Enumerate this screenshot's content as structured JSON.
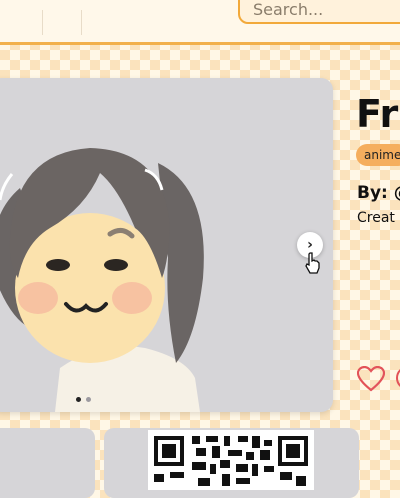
{
  "header": {
    "search": {
      "placeholder": "Search..."
    }
  },
  "mii": {
    "title": "Fri",
    "tags": [
      "anime"
    ],
    "author_prefix": "By: @",
    "created_label": "Creat",
    "carousel": {
      "slide_count": 2,
      "active_index": 0
    }
  },
  "icons": {
    "next": "chevron-right-icon",
    "cursor": "hand-pointer-icon",
    "like": "heart-icon"
  },
  "colors": {
    "accent": "#f2b04b",
    "tag": "#f5ae5e",
    "heart": "#e2535a",
    "card": "#d6d5d8"
  }
}
